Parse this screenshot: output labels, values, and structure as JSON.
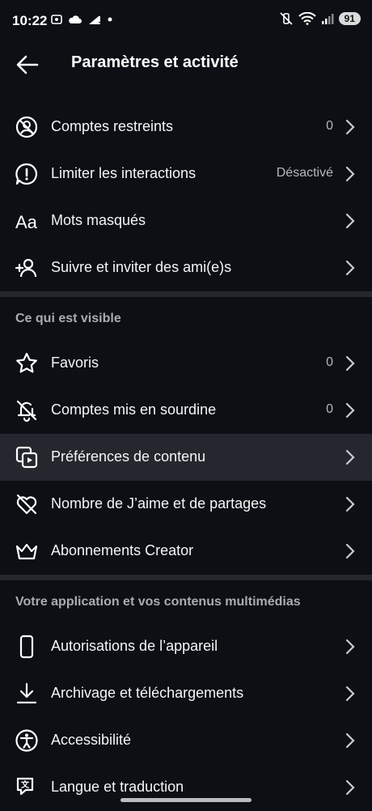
{
  "status": {
    "time": "10:22",
    "battery": "91"
  },
  "header": {
    "title": "Paramètres et activité"
  },
  "group1": [
    {
      "label": "Comptes restreints",
      "value": "0",
      "icon": "restricted-icon"
    },
    {
      "label": "Limiter les interactions",
      "value": "Désactivé",
      "icon": "limit-icon"
    },
    {
      "label": "Mots masqués",
      "value": "",
      "icon": "text-aa-icon"
    },
    {
      "label": "Suivre et inviter des ami(e)s",
      "value": "",
      "icon": "add-person-icon"
    }
  ],
  "sections": {
    "visible": "Ce qui est visible",
    "app": "Votre application et vos contenus multimédias"
  },
  "group2": [
    {
      "label": "Favoris",
      "value": "0",
      "icon": "star-icon"
    },
    {
      "label": "Comptes mis en sourdine",
      "value": "0",
      "icon": "mute-bell-icon"
    },
    {
      "label": "Préférences de contenu",
      "value": "",
      "icon": "content-icon"
    },
    {
      "label": "Nombre de J’aime et de partages",
      "value": "",
      "icon": "heart-off-icon"
    },
    {
      "label": "Abonnements Creator",
      "value": "",
      "icon": "crown-icon"
    }
  ],
  "group3": [
    {
      "label": "Autorisations de l’appareil",
      "value": "",
      "icon": "phone-icon"
    },
    {
      "label": "Archivage et téléchargements",
      "value": "",
      "icon": "download-icon"
    },
    {
      "label": "Accessibilité",
      "value": "",
      "icon": "accessibility-icon"
    },
    {
      "label": "Langue et traduction",
      "value": "",
      "icon": "translate-icon"
    }
  ]
}
